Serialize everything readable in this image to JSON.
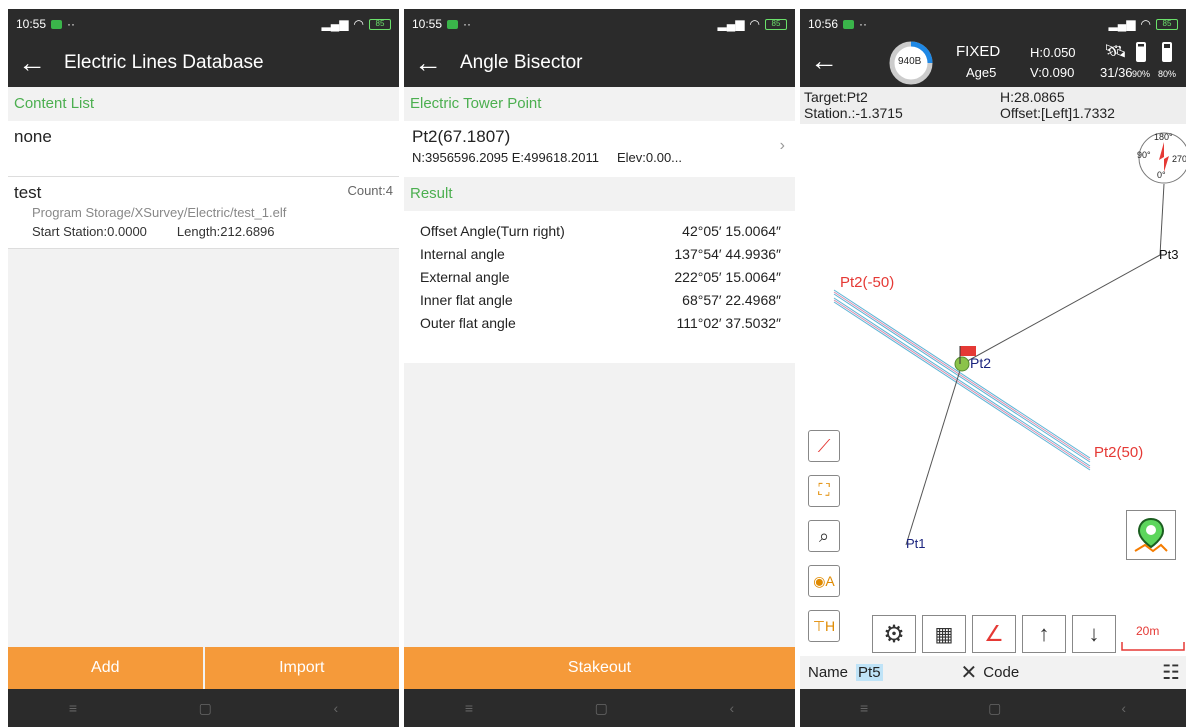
{
  "panel1": {
    "status": {
      "time": "10:55",
      "dots": "··",
      "battery": "85"
    },
    "title": "Electric Lines Database",
    "section": "Content List",
    "items": [
      {
        "name": "none"
      },
      {
        "name": "test",
        "count": "Count:4",
        "path": "Program Storage/XSurvey/Electric/test_1.elf",
        "start": "Start Station:0.0000",
        "length": "Length:212.6896"
      }
    ],
    "buttons": {
      "add": "Add",
      "import": "Import"
    }
  },
  "panel2": {
    "status": {
      "time": "10:55",
      "dots": "··",
      "battery": "85"
    },
    "title": "Angle Bisector",
    "section_tower": "Electric Tower Point",
    "point": {
      "name": "Pt2(67.1807)",
      "ne": "N:3956596.2095 E:499618.2011",
      "elev": "Elev:0.00..."
    },
    "section_result": "Result",
    "results": [
      {
        "label": "Offset Angle(Turn right)",
        "value": "42°05′ 15.0064″"
      },
      {
        "label": "Internal angle",
        "value": "137°54′ 44.9936″"
      },
      {
        "label": "External angle",
        "value": "222°05′ 15.0064″"
      },
      {
        "label": "Inner flat angle",
        "value": "68°57′ 22.4968″"
      },
      {
        "label": "Outer flat angle",
        "value": "111°02′ 37.5032″"
      }
    ],
    "button": "Stakeout"
  },
  "panel3": {
    "status": {
      "time": "10:56",
      "dots": "··",
      "battery": "85"
    },
    "gauge": "940B",
    "fix": "FIXED",
    "age": "Age5",
    "h": "H:0.050",
    "v": "V:0.090",
    "sats": "31/36",
    "bat1": "90%",
    "bat2": "80%",
    "target": "Target:Pt2",
    "station": "Station.:-1.3715",
    "hval": "H:28.0865",
    "offset": "Offset:[Left]1.7332",
    "labels": {
      "pt3": "Pt3",
      "pt2m": "Pt2(-50)",
      "pt2": "Pt2",
      "pt2p": "Pt2(50)",
      "pt1": "Pt1"
    },
    "compass": {
      "n": "180°",
      "w": "90°",
      "e": "270°",
      "s": "0°"
    },
    "scale": "20m",
    "name_label": "Name",
    "name_value": "Pt5",
    "code_label": "Code",
    "colors": {
      "accent_orange": "#f59a3a",
      "section_green": "#4caf50",
      "dark_bar": "#2b2b2b",
      "line_red": "#e53935",
      "label_blue": "#1a237e"
    }
  }
}
